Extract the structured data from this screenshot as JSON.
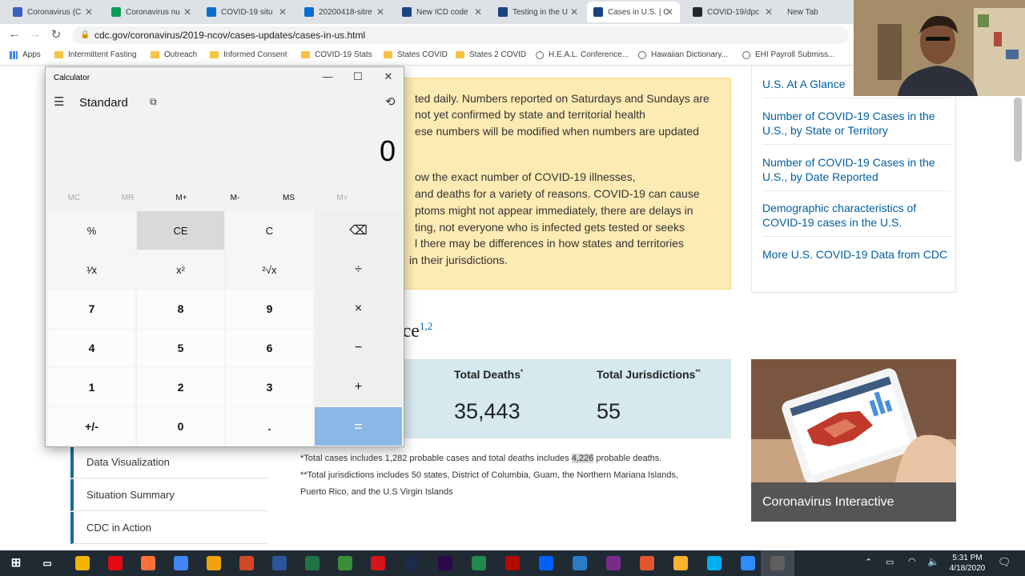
{
  "browser": {
    "tabs": [
      {
        "label": "Coronavirus (C",
        "icon": "sheets-icon",
        "color": "#3b5fc0"
      },
      {
        "label": "Coronavirus nu",
        "icon": "sheets-icon",
        "color": "#0f9d58"
      },
      {
        "label": "COVID-19 situ",
        "icon": "who-icon",
        "color": "#0a6ed1"
      },
      {
        "label": "20200418-sitre",
        "icon": "who-icon",
        "color": "#0a6ed1"
      },
      {
        "label": "New ICD code",
        "icon": "cdc-icon",
        "color": "#1a4480"
      },
      {
        "label": "Testing in the U",
        "icon": "cdc-icon",
        "color": "#1a4480"
      },
      {
        "label": "Cases in U.S. | C",
        "icon": "cdc-icon",
        "color": "#1a4480"
      },
      {
        "label": "COVID-19/dpc",
        "icon": "github-icon",
        "color": "#24292e"
      },
      {
        "label": "New Tab",
        "icon": "",
        "color": ""
      }
    ],
    "url": "cdc.gov/coronavirus/2019-ncov/cases-updates/cases-in-us.html",
    "bookmarks": [
      "Apps",
      "Intermittent Fasting",
      "Outreach",
      "Informed Consent",
      "COVID-19 Stats",
      "States COVID",
      "States 2 COVID",
      "H.E.A.L. Conference...",
      "Hawaiian Dictionary...",
      "EHI Payroll Submiss..."
    ]
  },
  "page": {
    "alert_lines": [
      "ted daily. Numbers reported on Saturdays and Sundays are",
      "not yet confirmed by state and territorial health",
      "ese numbers will be modified when numbers are updated",
      "",
      "ow the exact number of COVID-19 illnesses,",
      "and deaths for a variety of reasons. COVID-19 can cause",
      "ptoms might not appear immediately, there are delays in",
      "ting, not everyone who is infected gets tested or seeks",
      "l there may be differences in how states and territories",
      "in their jurisdictions."
    ],
    "heading": "ance",
    "heading_sup": "1,2",
    "stats": {
      "deaths_label": "Total Deaths",
      "deaths_sup": "*",
      "deaths_value": "35,443",
      "jurisdictions_label": "Total Jurisdictions",
      "jurisdictions_sup": "**",
      "jurisdictions_value": "55"
    },
    "footnote1_pre": "*Total cases includes 1,282 probable cases and total deaths includes ",
    "footnote1_hl": "4,226",
    "footnote1_post": " probable deaths.",
    "footnote2": "**Total jurisdictions includes 50 states, District of Columbia, Guam, the Northern Mariana Islands,",
    "footnote3": "Puerto Rico, and the U.S Virgin Islands",
    "sidenav": [
      "U.S. At A Glance",
      "Number of COVID-19 Cases in the U.S., by State or Territory",
      "Number of COVID-19 Cases in the U.S., by Date Reported",
      "Demographic characteristics of COVID-19 cases in the U.S.",
      "More U.S. COVID-19 Data from CDC"
    ],
    "promo_caption": "Coronavirus Interactive",
    "leftnav": [
      "Data Visualization",
      "Situation Summary",
      "CDC in Action"
    ]
  },
  "calculator": {
    "title": "Calculator",
    "mode": "Standard",
    "display": "0",
    "memory": [
      "MC",
      "MR",
      "M+",
      "M-",
      "MS",
      "M˅"
    ],
    "keys": [
      [
        "%",
        "CE",
        "C",
        "⌫"
      ],
      [
        "¹⁄x",
        "x²",
        "²√x",
        "÷"
      ],
      [
        "7",
        "8",
        "9",
        "×"
      ],
      [
        "4",
        "5",
        "6",
        "−"
      ],
      [
        "1",
        "2",
        "3",
        "+"
      ],
      [
        "+/-",
        "0",
        ".",
        "="
      ]
    ]
  },
  "taskbar": {
    "time": "5:31 PM",
    "date": "4/18/2020"
  }
}
